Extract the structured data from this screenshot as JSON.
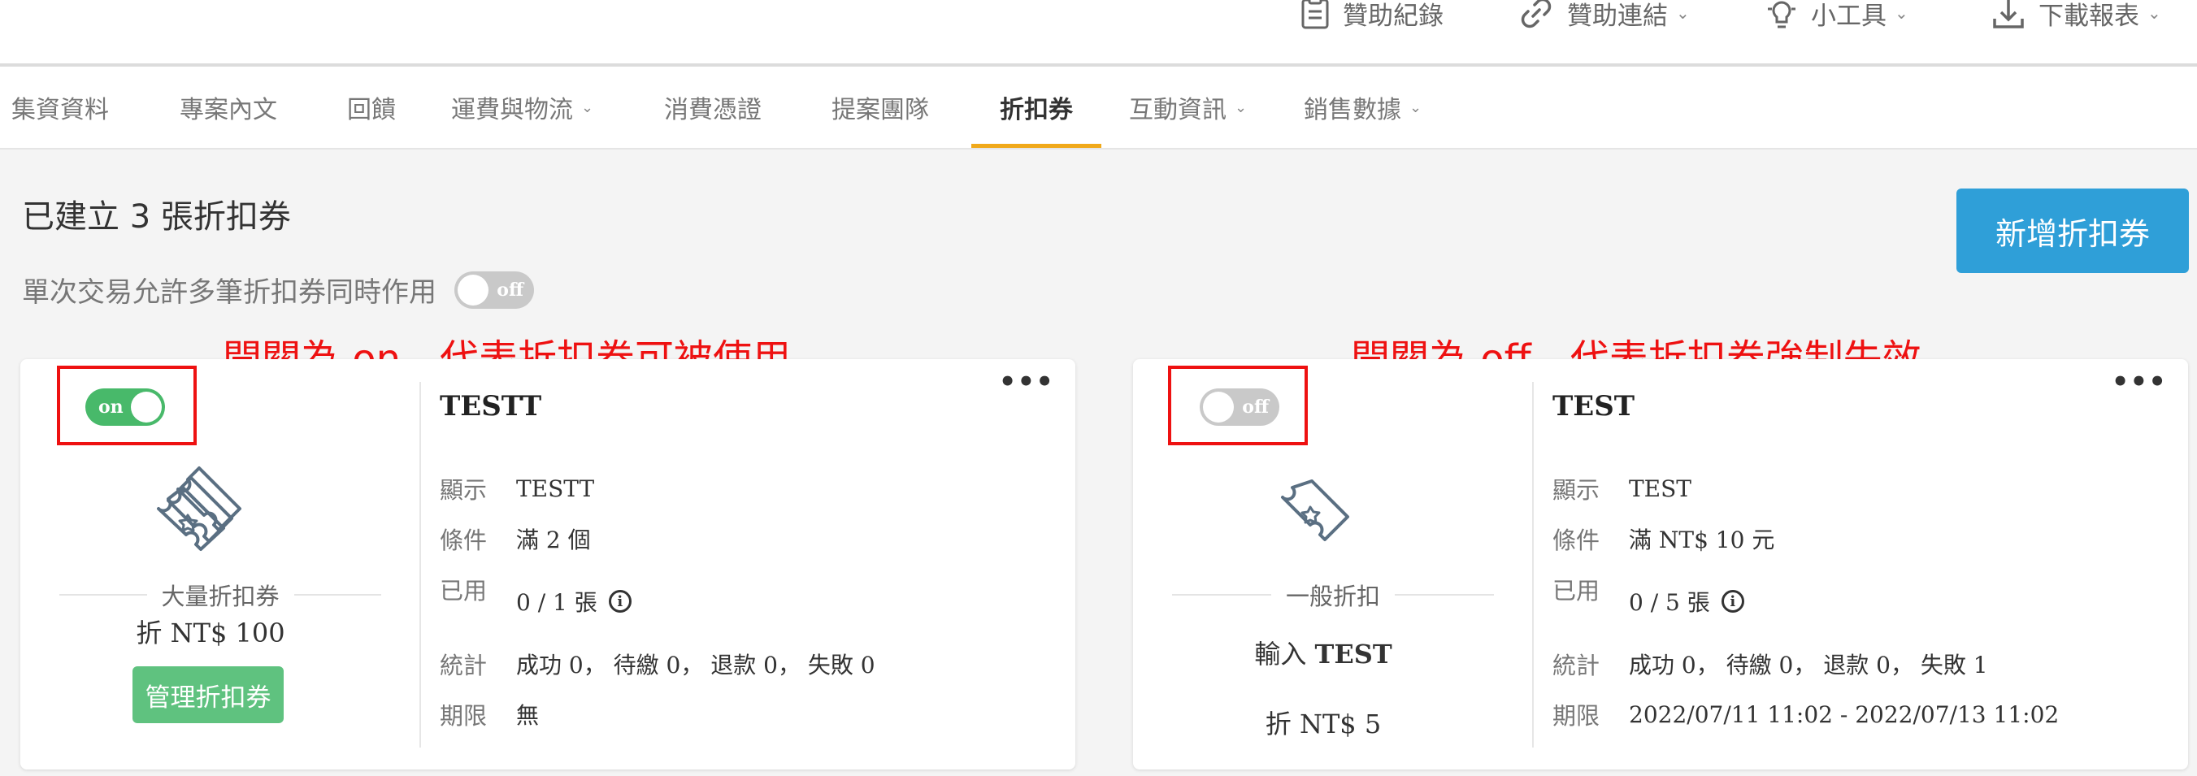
{
  "toolbar": {
    "sponsor_records": "贊助紀錄",
    "sponsor_link": "贊助連結",
    "tools": "小工具",
    "download_report": "下載報表"
  },
  "tabs": [
    {
      "label": "集資資料"
    },
    {
      "label": "專案內文"
    },
    {
      "label": "回饋"
    },
    {
      "label": "運費與物流"
    },
    {
      "label": "消費憑證"
    },
    {
      "label": "提案團隊"
    },
    {
      "label": "折扣券",
      "active": true
    },
    {
      "label": "互動資訊"
    },
    {
      "label": "銷售數據"
    }
  ],
  "header": {
    "title": "已建立 3 張折扣券",
    "add_button": "新增折扣券",
    "multi_coupon_label": "單次交易允許多筆折扣券同時作用",
    "multi_coupon_toggle": "off"
  },
  "annotations": {
    "on_note": "開關為 on，代表折扣券可被使用",
    "off_note": "開關為 off，代表折扣券強制失效"
  },
  "cards": [
    {
      "toggle": "on",
      "icon": "bulk-ticket-icon",
      "type": "大量折扣券",
      "discount": "折 NT$ 100",
      "manage_button": "管理折扣券",
      "title": "TESTT",
      "rows": [
        {
          "key": "顯示",
          "value": "TESTT"
        },
        {
          "key": "條件",
          "value": "滿 2 個"
        },
        {
          "key": "已用",
          "value": "0 / 1 張"
        },
        {
          "key": "統計",
          "value": "成功 0， 待繳 0， 退款 0， 失敗 0"
        },
        {
          "key": "期限",
          "value": "無"
        }
      ]
    },
    {
      "toggle": "off",
      "icon": "ticket-icon",
      "type": "一般折扣",
      "code_prefix": "輸入",
      "code": "TEST",
      "discount": "折 NT$ 5",
      "title": "TEST",
      "rows": [
        {
          "key": "顯示",
          "value": "TEST"
        },
        {
          "key": "條件",
          "value": "滿 NT$ 10 元"
        },
        {
          "key": "已用",
          "value": "0 / 5 張"
        },
        {
          "key": "統計",
          "value": "成功 0， 待繳 0， 退款 0， 失敗 1"
        },
        {
          "key": "期限",
          "value": "2022/07/11 11:02 - 2022/07/13 11:02"
        }
      ]
    }
  ],
  "colors": {
    "accent_tab": "#f0a91a",
    "primary_button": "#2f9fd8",
    "manage_button": "#5fc27f",
    "toggle_on": "#48b96a",
    "toggle_off": "#c9c9c9",
    "annotation": "#ee1111"
  }
}
